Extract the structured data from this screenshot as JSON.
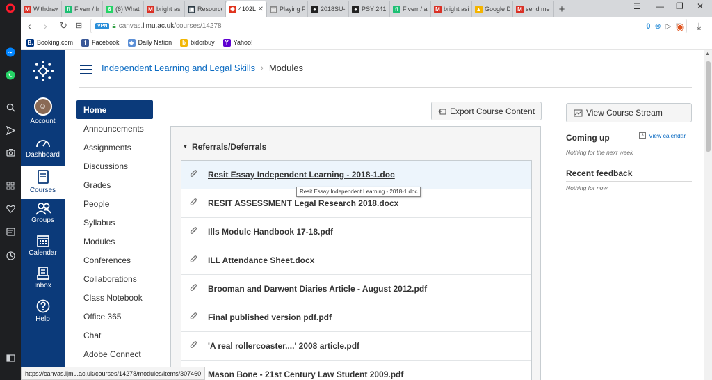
{
  "browser": {
    "tabs": [
      {
        "label": "Withdraw",
        "icon": "gmail-icon",
        "color": "#d93025",
        "glyph": "M"
      },
      {
        "label": "Fiverr / In",
        "icon": "fiverr-icon",
        "color": "#1dbf73",
        "glyph": "fi"
      },
      {
        "label": "(6) Whats",
        "icon": "whatsapp-icon",
        "color": "#25d366",
        "glyph": "6"
      },
      {
        "label": "bright asi",
        "icon": "gmail-icon",
        "color": "#d93025",
        "glyph": "M"
      },
      {
        "label": "Resource",
        "icon": "canvas-icon",
        "color": "#2d3b45",
        "glyph": "▣"
      },
      {
        "label": "4102L",
        "icon": "canvas-icon",
        "color": "#e0341e",
        "glyph": "✺",
        "active": true
      },
      {
        "label": "Playing F",
        "icon": "document-icon",
        "color": "#888888",
        "glyph": "▤"
      },
      {
        "label": "2018SU-F",
        "icon": "person-icon",
        "color": "#222222",
        "glyph": "●"
      },
      {
        "label": "PSY 241 (",
        "icon": "person-icon",
        "color": "#222222",
        "glyph": "●"
      },
      {
        "label": "Fiverr / ar",
        "icon": "fiverr-icon",
        "color": "#1dbf73",
        "glyph": "fi"
      },
      {
        "label": "bright asi",
        "icon": "gmail-icon",
        "color": "#d93025",
        "glyph": "M"
      },
      {
        "label": "Google D",
        "icon": "google-drive-icon",
        "color": "#f4b400",
        "glyph": "▲"
      },
      {
        "label": "send me",
        "icon": "gmail-icon",
        "color": "#d93025",
        "glyph": "M"
      }
    ],
    "new_tab": "+",
    "url_prefix": "canvas.",
    "url_host": "ljmu.ac.uk",
    "url_path": "/courses/14278",
    "vpn_label": "VPN",
    "badge_count": "0",
    "bookmarks": [
      {
        "label": "Booking.com",
        "color": "#003580",
        "glyph": "B."
      },
      {
        "label": "Facebook",
        "color": "#3b5998",
        "glyph": "f"
      },
      {
        "label": "Daily Nation",
        "color": "#5b8fd6",
        "glyph": "◆"
      },
      {
        "label": "bidorbuy",
        "color": "#f2b705",
        "glyph": "b"
      },
      {
        "label": "Yahoo!",
        "color": "#5f01d1",
        "glyph": "Y"
      }
    ]
  },
  "global_nav": {
    "account": "Account",
    "dashboard": "Dashboard",
    "courses": "Courses",
    "groups": "Groups",
    "calendar": "Calendar",
    "inbox": "Inbox",
    "help": "Help"
  },
  "breadcrumb": {
    "course": "Independent Learning and Legal Skills",
    "separator": "›",
    "page": "Modules"
  },
  "course_nav": [
    "Home",
    "Announcements",
    "Assignments",
    "Discussions",
    "Grades",
    "People",
    "Syllabus",
    "Modules",
    "Conferences",
    "Collaborations",
    "Class Notebook",
    "Office 365",
    "Chat",
    "Adobe Connect"
  ],
  "export_button": "Export Course Content",
  "module": {
    "title": "Referrals/Deferrals",
    "items": [
      "Resit Essay Independent Learning - 2018-1.doc",
      "RESIT ASSESSMENT Legal Research 2018.docx",
      "Ills Module Handbook 17-18.pdf",
      "ILL Attendance Sheet.docx",
      "Brooman and Darwent Diaries Article - August 2012.pdf",
      "Final published version pdf.pdf",
      "'A real rollercoaster....' 2008 article.pdf",
      "Mason Bone - 21st Century Law Student 2009.pdf"
    ]
  },
  "tooltip": "Resit Essay Independent Learning - 2018-1.doc",
  "sidebar": {
    "stream_button": "View Course Stream",
    "coming_up": "Coming up",
    "view_calendar": "View calendar",
    "calendar_day": "3",
    "coming_up_note": "Nothing for the next week",
    "recent_feedback": "Recent feedback",
    "recent_feedback_note": "Nothing for now"
  },
  "status_url": "https://canvas.ljmu.ac.uk/courses/14278/modules/items/307460",
  "colors": {
    "canvas_nav": "#0b3a7a",
    "link": "#0b6bc2",
    "opera_red": "#ff1b2d"
  }
}
